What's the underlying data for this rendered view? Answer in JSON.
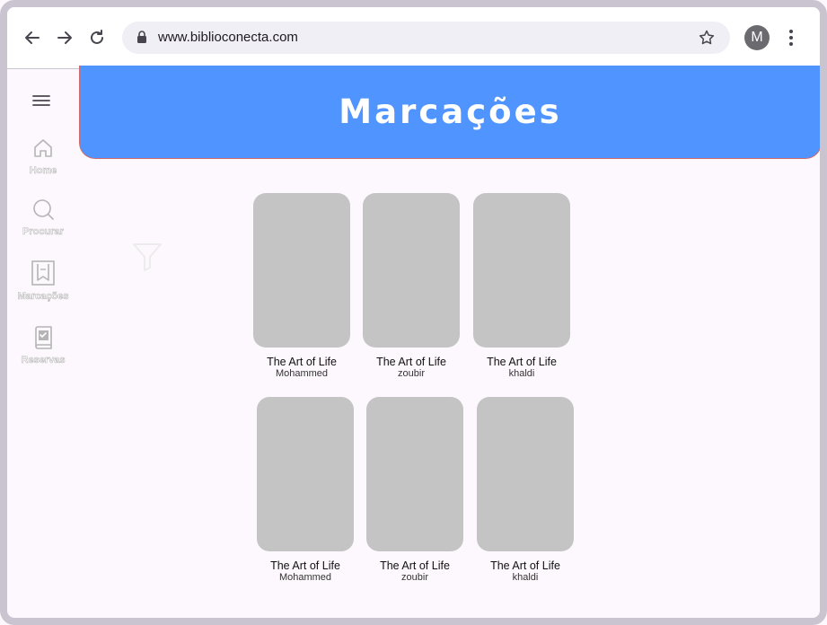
{
  "browser": {
    "url": "www.biblioconecta.com",
    "avatar_letter": "M",
    "icons": [
      "back-arrow-icon",
      "forward-arrow-icon",
      "reload-icon",
      "lock-icon",
      "bookmark-star-icon",
      "more-vert-icon"
    ]
  },
  "sidebar": {
    "items": [
      {
        "label": "Home",
        "icon": "home-icon"
      },
      {
        "label": "Procurar",
        "icon": "search-icon"
      },
      {
        "label": "Marcações",
        "icon": "bookmark-icon"
      },
      {
        "label": "Reservas",
        "icon": "reservation-book-icon"
      }
    ]
  },
  "page": {
    "title": "Marcações",
    "accent_color": "#5094ff"
  },
  "books": [
    {
      "title": "The Art of Life",
      "author": "Mohammed"
    },
    {
      "title": "The Art of Life",
      "author": "zoubir"
    },
    {
      "title": "The Art of Life",
      "author": "khaldi"
    },
    {
      "title": "The Art of Life",
      "author": "Mohammed"
    },
    {
      "title": "The Art of Life",
      "author": "zoubir"
    },
    {
      "title": "The Art of Life",
      "author": "khaldi"
    }
  ]
}
